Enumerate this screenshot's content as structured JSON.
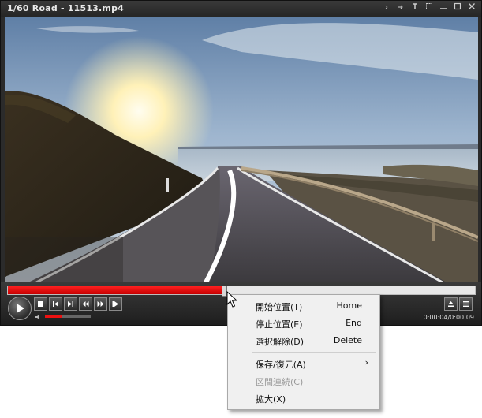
{
  "window": {
    "title": "1/60 Road - 11513.mp4",
    "titlebar_icons": [
      "chevron-right-icon",
      "pin-icon",
      "always-on-top-icon",
      "fullscreen-icon",
      "minimize-icon",
      "maximize-icon",
      "close-icon"
    ]
  },
  "player": {
    "seek_progress": 0.46,
    "volume_level": 0.38,
    "time_display": "0:00:04/0:00:09",
    "accent_color": "#e00000"
  },
  "context_menu": {
    "items": [
      {
        "label": "開始位置(T)",
        "shortcut": "Home",
        "enabled": true
      },
      {
        "label": "停止位置(E)",
        "shortcut": "End",
        "enabled": true
      },
      {
        "label": "選択解除(D)",
        "shortcut": "Delete",
        "enabled": true
      },
      {
        "label": "保存/復元(A)",
        "submenu_arrow": "›",
        "enabled": true
      },
      {
        "label": "区間連続(C)",
        "enabled": false
      },
      {
        "label": "拡大(X)",
        "enabled": true
      }
    ]
  }
}
